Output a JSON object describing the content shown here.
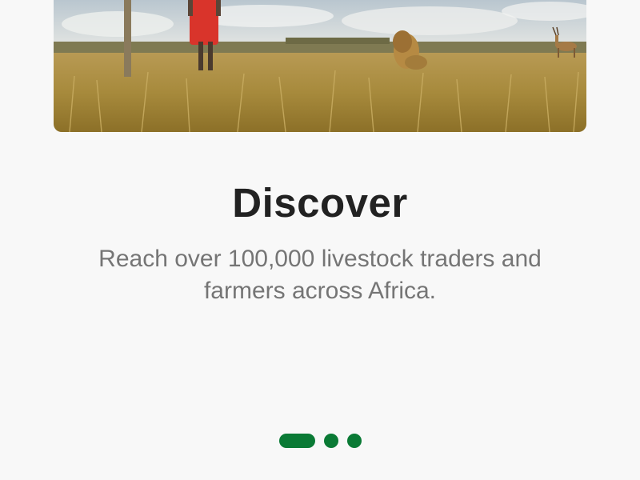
{
  "onboarding": {
    "title": "Discover",
    "description": "Reach over 100,000 livestock traders and farmers across Africa.",
    "hero_image": "savanna-scene-herder-lion-antelope",
    "pager": {
      "pages": [
        "page-1",
        "page-2",
        "page-3"
      ],
      "active_index": 0,
      "active_color": "#0a7a35"
    }
  }
}
